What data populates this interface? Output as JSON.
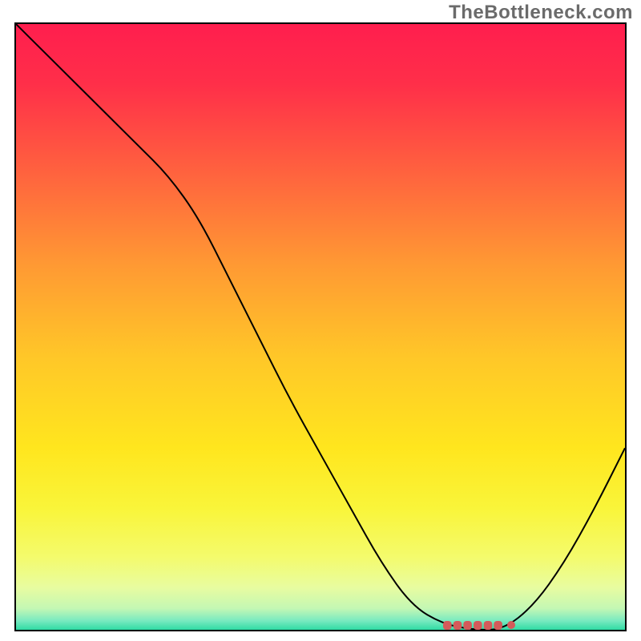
{
  "watermark": "TheBottleneck.com",
  "colors": {
    "curve": "#000000",
    "marker": "#d45a5a",
    "gradient_stops": [
      {
        "offset": 0.0,
        "color": "#ff1e4e"
      },
      {
        "offset": 0.1,
        "color": "#ff2f49"
      },
      {
        "offset": 0.25,
        "color": "#ff643e"
      },
      {
        "offset": 0.4,
        "color": "#ff9a33"
      },
      {
        "offset": 0.55,
        "color": "#ffc728"
      },
      {
        "offset": 0.7,
        "color": "#ffe61e"
      },
      {
        "offset": 0.8,
        "color": "#f9f53a"
      },
      {
        "offset": 0.88,
        "color": "#f4fb6c"
      },
      {
        "offset": 0.93,
        "color": "#e8fca0"
      },
      {
        "offset": 0.965,
        "color": "#c3f7b4"
      },
      {
        "offset": 0.985,
        "color": "#79eac0"
      },
      {
        "offset": 1.0,
        "color": "#2fdba4"
      }
    ]
  },
  "chart_data": {
    "type": "line",
    "title": "",
    "xlabel": "",
    "ylabel": "",
    "xlim": [
      0,
      100
    ],
    "ylim": [
      0,
      100
    ],
    "x": [
      0,
      5,
      10,
      15,
      20,
      25,
      30,
      35,
      40,
      45,
      50,
      55,
      60,
      65,
      70,
      75,
      80,
      85,
      90,
      95,
      100
    ],
    "values": [
      100,
      95,
      90,
      85,
      80,
      75,
      68,
      58,
      48,
      38,
      29,
      20,
      11,
      4,
      1,
      0,
      0,
      4,
      11,
      20,
      30
    ],
    "optimum_x_range": [
      70,
      80
    ],
    "optimum_y": 0
  }
}
